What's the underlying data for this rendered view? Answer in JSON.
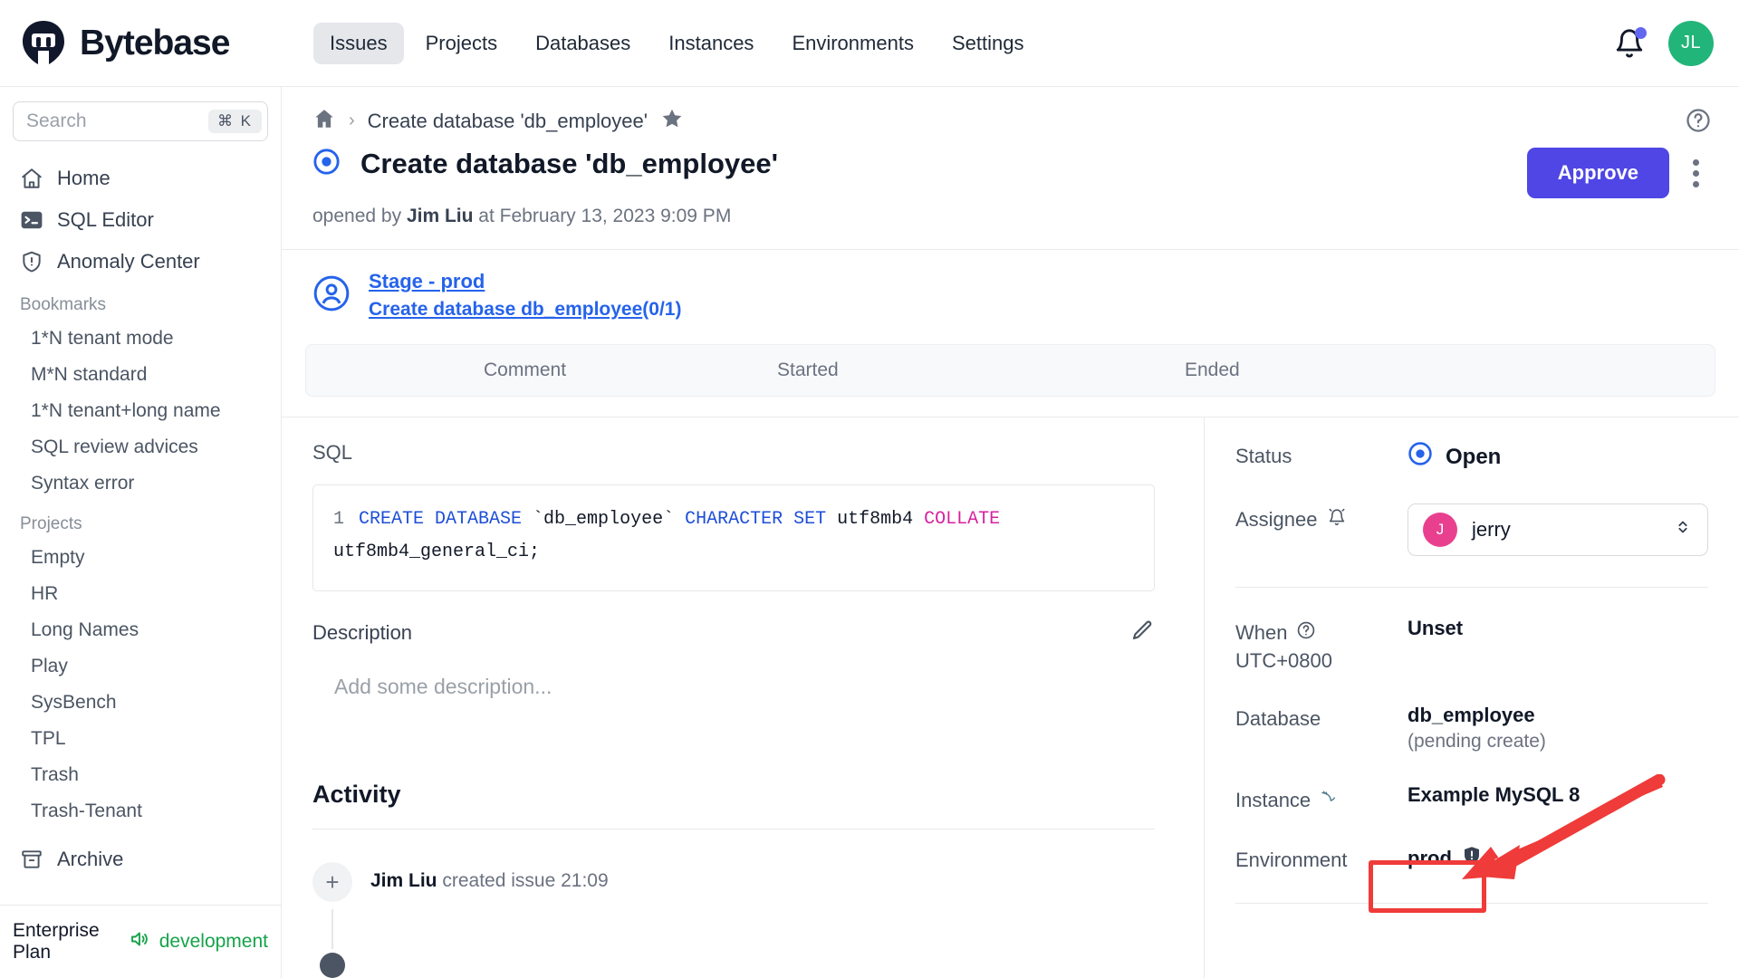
{
  "app": {
    "brand": "Bytebase",
    "logo_icon": "bytebase-logo-icon"
  },
  "topnav": {
    "items": [
      {
        "label": "Issues",
        "active": true
      },
      {
        "label": "Projects",
        "active": false
      },
      {
        "label": "Databases",
        "active": false
      },
      {
        "label": "Instances",
        "active": false
      },
      {
        "label": "Environments",
        "active": false
      },
      {
        "label": "Settings",
        "active": false
      }
    ],
    "bell_icon": "notification-bell-icon",
    "avatar_initials": "JL",
    "avatar_color": "#22b579"
  },
  "sidebar": {
    "search": {
      "placeholder": "Search",
      "shortcut": "⌘ K"
    },
    "links": [
      {
        "label": "Home",
        "icon": "home-icon"
      },
      {
        "label": "SQL Editor",
        "icon": "sql-editor-icon"
      },
      {
        "label": "Anomaly Center",
        "icon": "shield-alert-icon"
      }
    ],
    "bookmarks_title": "Bookmarks",
    "bookmarks": [
      "1*N tenant mode",
      "M*N standard",
      "1*N tenant+long name",
      "SQL review advices",
      "Syntax error"
    ],
    "projects_title": "Projects",
    "projects": [
      "Empty",
      "HR",
      "Long Names",
      "Play",
      "SysBench",
      "TPL",
      "Trash",
      "Trash-Tenant"
    ],
    "archive": {
      "label": "Archive",
      "icon": "archive-box-icon"
    },
    "footer": {
      "plan": "Enterprise Plan",
      "speaker_icon": "speaker-icon",
      "environment": "development"
    }
  },
  "breadcrumb": {
    "home_icon": "home-icon",
    "separator": "›",
    "current": "Create database 'db_employee'",
    "star_icon": "star-filled-icon",
    "help_icon": "help-circle-icon"
  },
  "issue": {
    "status_icon": "open-circle-icon",
    "title": "Create database 'db_employee'",
    "approve_label": "Approve",
    "kebab_icon": "more-vertical-icon",
    "opened_prefix": "opened by",
    "opened_author": "Jim Liu",
    "opened_middle": "at",
    "opened_time": "February 13, 2023 9:09 PM"
  },
  "stage": {
    "avatar_icon": "user-circle-icon",
    "stage_link": "Stage - prod",
    "task_link": "Create database db_employee",
    "task_count": "(0/1)"
  },
  "task_table": {
    "columns": [
      "Comment",
      "Started",
      "Ended"
    ]
  },
  "sql_section": {
    "label": "SQL",
    "line_number": "1",
    "tokens": [
      {
        "t": "CREATE DATABASE",
        "k": "kw"
      },
      {
        "t": " `db_employee` ",
        "k": ""
      },
      {
        "t": "CHARACTER SET",
        "k": "kw"
      },
      {
        "t": " utf8mb4 ",
        "k": ""
      },
      {
        "t": "COLLATE",
        "k": "kw2"
      },
      {
        "t": " utf8mb4_general_ci;",
        "k": ""
      }
    ],
    "full_text": "CREATE DATABASE `db_employee` CHARACTER SET utf8mb4 COLLATE utf8mb4_general_ci;"
  },
  "description": {
    "label": "Description",
    "edit_icon": "pencil-icon",
    "placeholder": "Add some description..."
  },
  "activity": {
    "title": "Activity",
    "items": [
      {
        "icon": "plus-icon",
        "author": "Jim Liu",
        "text": "created issue 21:09"
      }
    ]
  },
  "details": {
    "status": {
      "label": "Status",
      "value": "Open",
      "icon": "open-circle-icon"
    },
    "assignee": {
      "label": "Assignee",
      "bell_icon": "bell-small-icon",
      "initial": "J",
      "name": "jerry",
      "avatar_color": "#e8408f",
      "chevron_icon": "chevron-updown-icon"
    },
    "when": {
      "label": "When",
      "help_icon": "help-circle-icon",
      "timezone": "UTC+0800",
      "value": "Unset"
    },
    "database": {
      "label": "Database",
      "value": "db_employee",
      "sub": "(pending create)"
    },
    "instance": {
      "label": "Instance",
      "icon": "mysql-dolphin-icon",
      "value": "Example MySQL 8"
    },
    "environment": {
      "label": "Environment",
      "value": "prod",
      "icon": "shield-alert-filled-icon"
    }
  },
  "annotations": {
    "highlight_color": "#ef3b39",
    "arrow_icon": "red-arrow-icon",
    "box_icon": "red-highlight-box"
  }
}
